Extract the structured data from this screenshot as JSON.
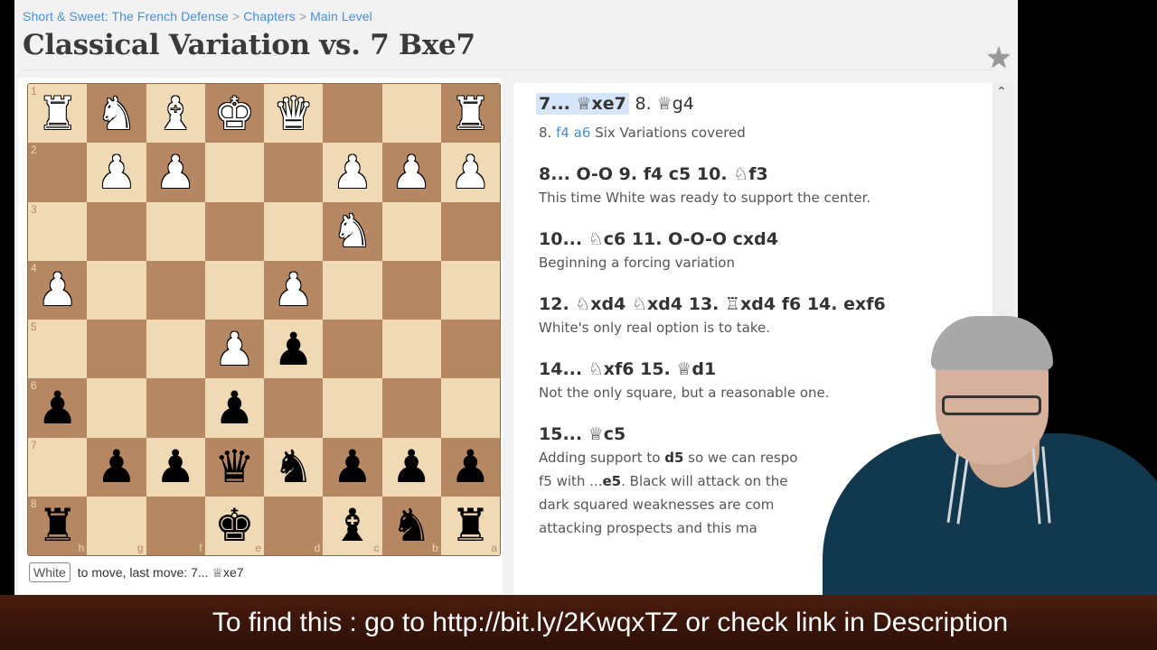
{
  "breadcrumb": [
    {
      "label": "Short & Sweet: The French Defense"
    },
    {
      "label": "Chapters"
    },
    {
      "label": "Main Level"
    }
  ],
  "breadcrumb_separator": ">",
  "page_title": "Classical Variation vs. 7 Bxe7",
  "star_icon": "★",
  "board": {
    "orientation": "black",
    "files_display": [
      "h",
      "g",
      "f",
      "e",
      "d",
      "c",
      "b",
      "a"
    ],
    "ranks_display": [
      "1",
      "2",
      "3",
      "4",
      "5",
      "6",
      "7",
      "8"
    ],
    "rows": [
      [
        "wR",
        "wN",
        "wB",
        "wK",
        "wQ",
        "",
        "",
        "wR"
      ],
      [
        "",
        "wP",
        "wP",
        "",
        "",
        "wP",
        "wP",
        "wP"
      ],
      [
        "",
        "",
        "",
        "",
        "",
        "wN",
        "",
        ""
      ],
      [
        "wP",
        "",
        "",
        "",
        "wP",
        "",
        "",
        ""
      ],
      [
        "",
        "",
        "",
        "wP",
        "bP",
        "",
        "",
        ""
      ],
      [
        "bP",
        "",
        "",
        "bP",
        "",
        "",
        "",
        ""
      ],
      [
        "",
        "bP",
        "bP",
        "bQ",
        "bN",
        "bP",
        "bP",
        "bP"
      ],
      [
        "bR",
        "",
        "",
        "bK",
        "",
        "bB",
        "bN",
        "bR"
      ]
    ]
  },
  "status": {
    "turn": "White",
    "text": "to move, last move: 7... ♕xe7"
  },
  "moves": {
    "line1": {
      "cur": "7... ♕xe7",
      "next": "8. ♕g4"
    },
    "alt": {
      "prefix": "8.",
      "link": "f4 a6",
      "text": "Six Variations covered"
    },
    "blocks": [
      {
        "line": "8... O-O  9. f4  c5  10. ♘f3",
        "note": "This time White was ready to support the center."
      },
      {
        "line": "10... ♘c6  11. O-O-O  cxd4",
        "note": "Beginning a forcing variation"
      },
      {
        "line": "12. ♘xd4  ♘xd4  13. ♖xd4  f6  14. exf6",
        "note": "White's only real option is to take."
      },
      {
        "line": "14... ♘xf6  15. ♕d1",
        "note": "Not the only square, but a reasonable one."
      }
    ],
    "last": {
      "line": "15... ♕c5",
      "note_parts": [
        "Adding support to ",
        "d5",
        " so we can respo",
        "f5 with ...",
        "e5",
        ". Black will attack on the",
        "dark squared weaknesses are com",
        "attacking prospects and this ma"
      ]
    }
  },
  "scroll_up_icon": "⌃",
  "caption": "To find this : go to http://bit.ly/2KwqxTZ or check link in Description"
}
